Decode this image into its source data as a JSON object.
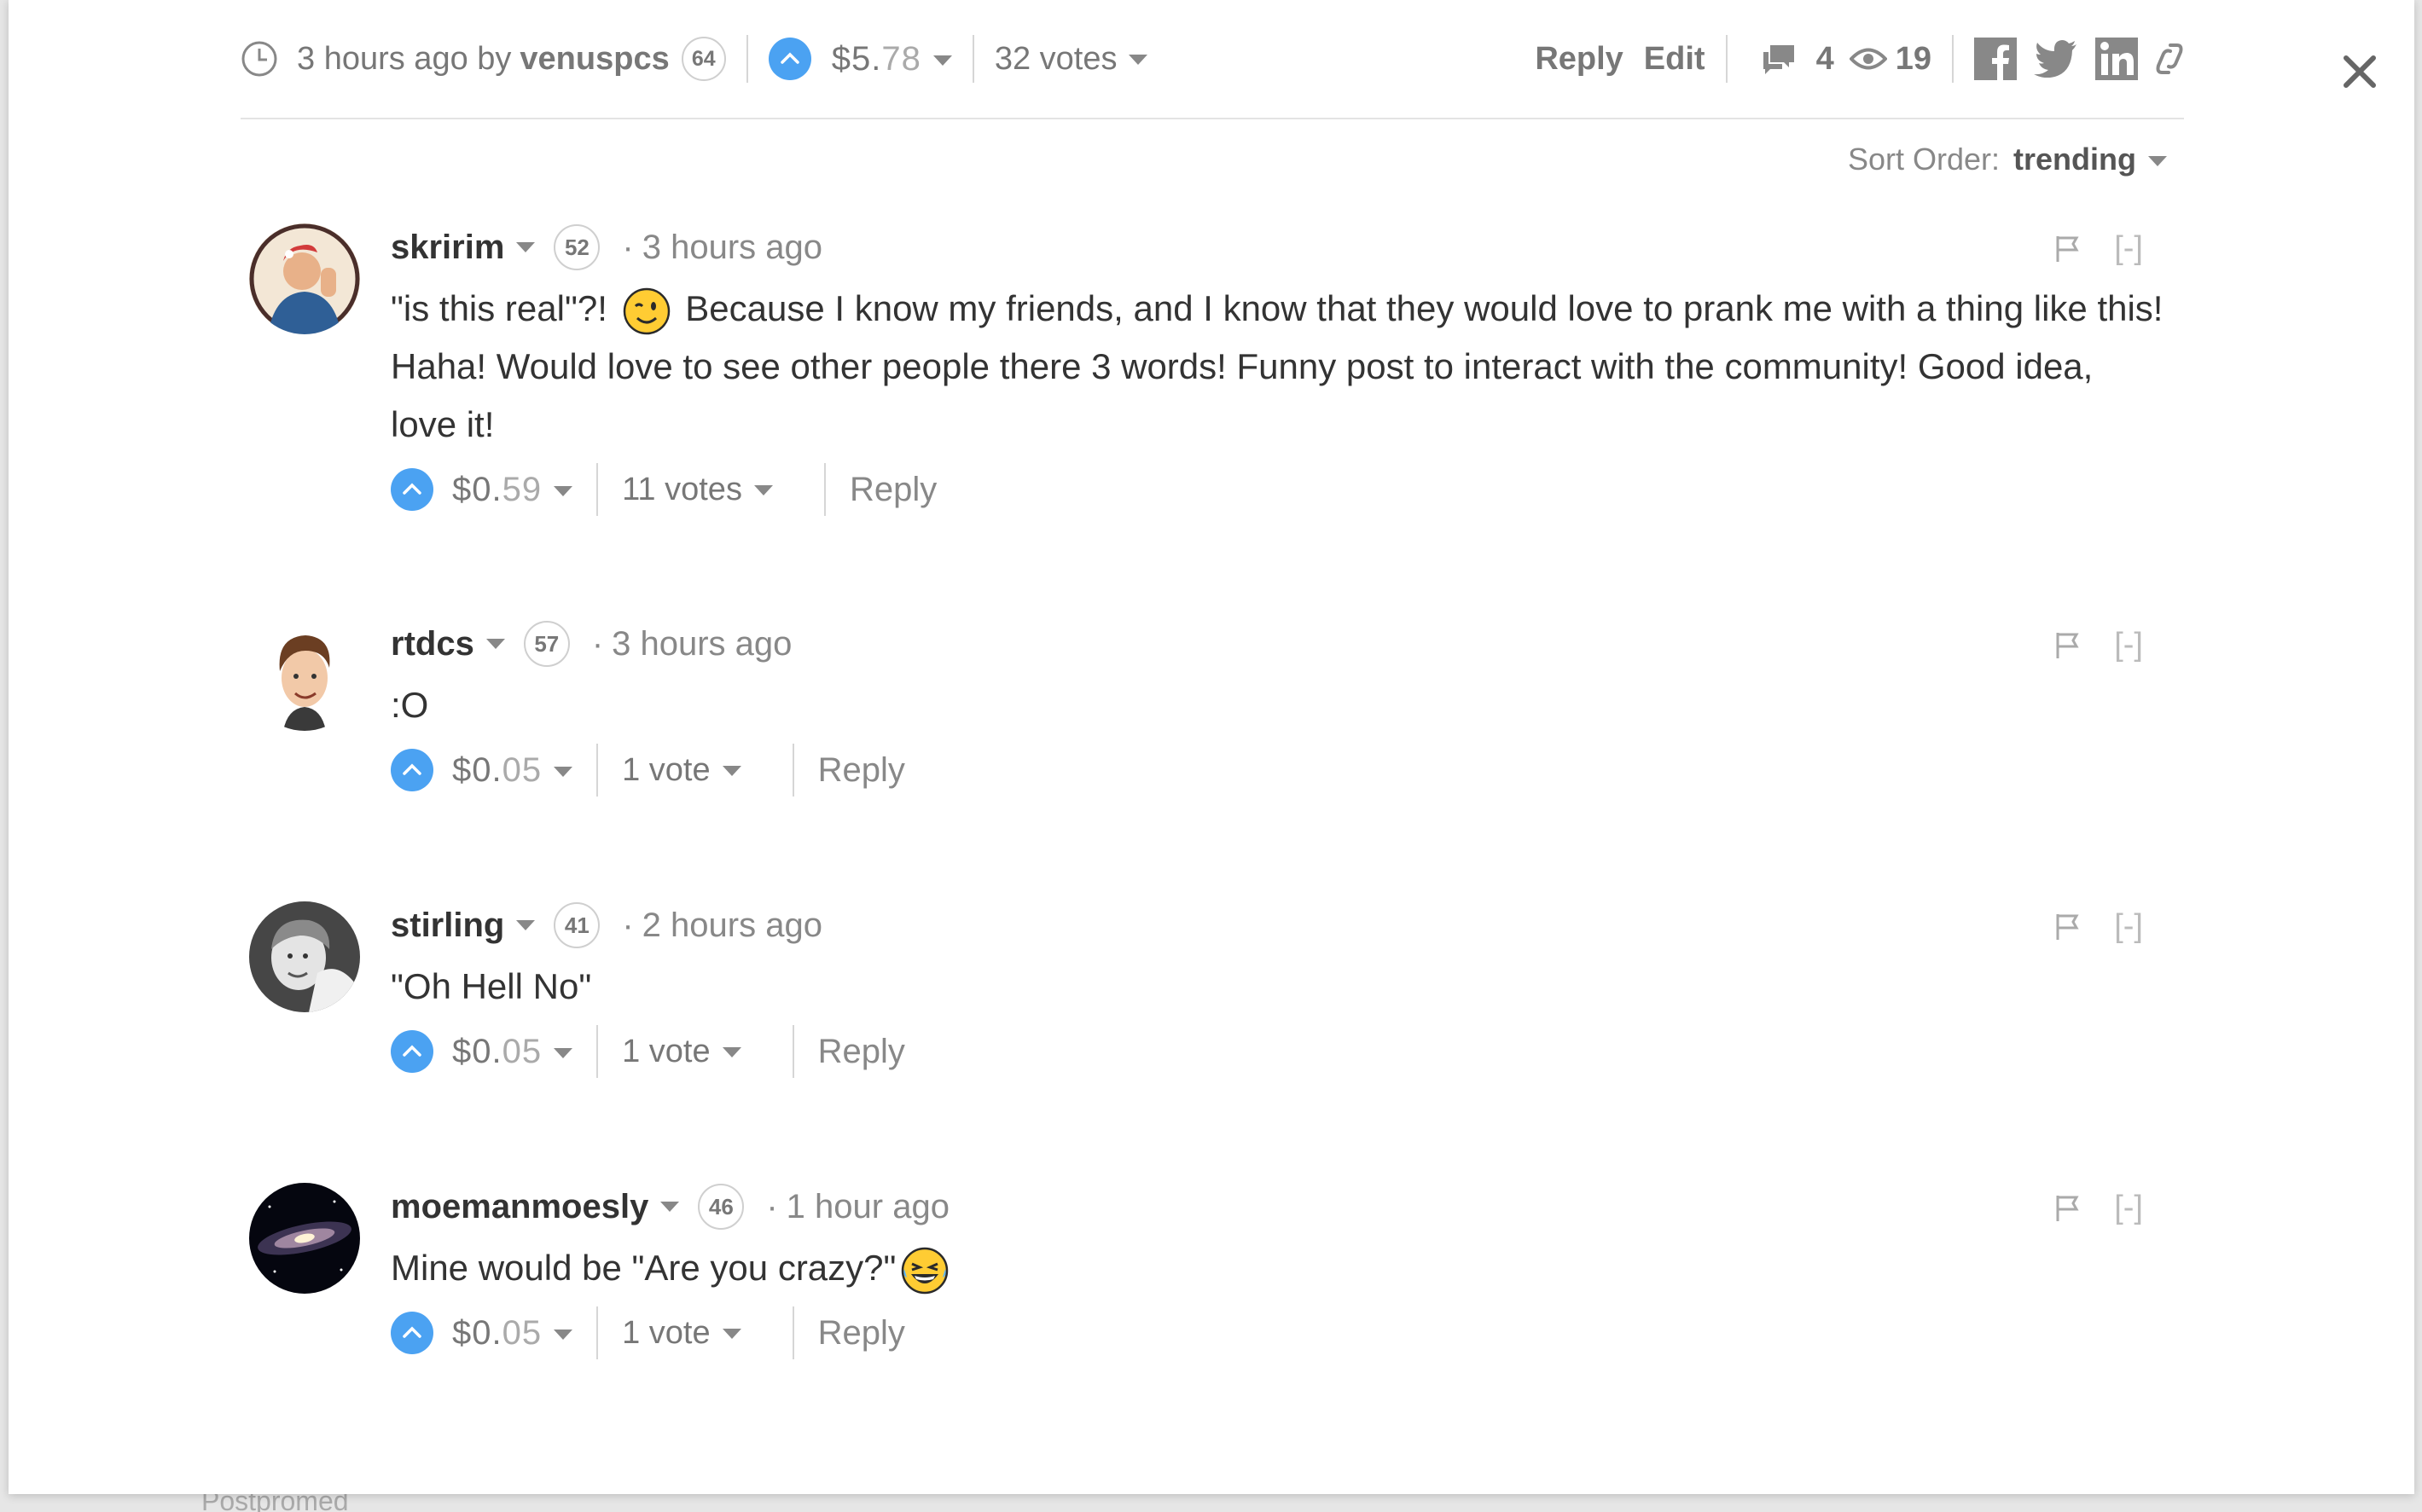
{
  "backdrop": {
    "hint": "Postpromed"
  },
  "post": {
    "time": "3 hours ago by",
    "author": "venuspcs",
    "reputation": "64",
    "payout": {
      "currency": "$",
      "whole": "5.",
      "decimals": "78"
    },
    "votes": "32 votes",
    "reply_label": "Reply",
    "edit_label": "Edit",
    "comments_count": "4",
    "views_count": "19"
  },
  "sort": {
    "label": "Sort Order:",
    "value": "trending"
  },
  "comments": [
    {
      "author": "skririm",
      "reputation": "52",
      "time": "3 hours ago",
      "text_before": "\"is this real\"?!",
      "text_after": "Because I know my friends, and I know that they would love to prank me with a thing like this! Haha! Would love to see other people there 3 words! Funny post to interact with the community! Good idea, love it!",
      "payout": {
        "currency": "$",
        "whole": "0.",
        "decimals": "59"
      },
      "votes": "11 votes",
      "reply": "Reply",
      "collapse": "[-]"
    },
    {
      "author": "rtdcs",
      "reputation": "57",
      "time": "3 hours ago",
      "text_before": ":O",
      "text_after": "",
      "payout": {
        "currency": "$",
        "whole": "0.",
        "decimals": "05"
      },
      "votes": "1 vote",
      "reply": "Reply",
      "collapse": "[-]"
    },
    {
      "author": "stirling",
      "reputation": "41",
      "time": "2 hours ago",
      "text_before": "\"Oh Hell No\"",
      "text_after": "",
      "payout": {
        "currency": "$",
        "whole": "0.",
        "decimals": "05"
      },
      "votes": "1 vote",
      "reply": "Reply",
      "collapse": "[-]"
    },
    {
      "author": "moemanmoesly",
      "reputation": "46",
      "time": "1 hour ago",
      "text_before": "Mine would be \"Are you crazy?\"",
      "text_after": "",
      "payout": {
        "currency": "$",
        "whole": "0.",
        "decimals": "05"
      },
      "votes": "1 vote",
      "reply": "Reply",
      "collapse": "[-]"
    }
  ],
  "colors": {
    "upvote": "#4ba2f2",
    "text": "#333333",
    "muted": "#888888"
  },
  "icons": {
    "clock": "clock-icon",
    "upvote": "chevron-up-icon",
    "comments": "comments-icon",
    "views": "eye-icon",
    "facebook": "facebook-icon",
    "twitter": "twitter-icon",
    "linkedin": "linkedin-icon",
    "link": "link-icon",
    "flag": "flag-icon",
    "close": "close-icon"
  }
}
